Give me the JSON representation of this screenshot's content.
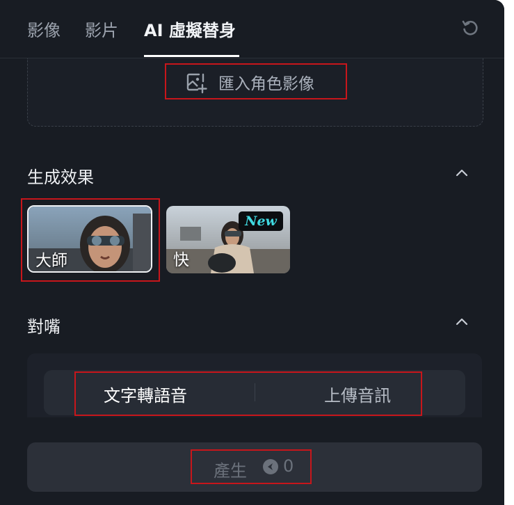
{
  "tabs": [
    {
      "label": "影像",
      "active": false
    },
    {
      "label": "影片",
      "active": false
    },
    {
      "label": "AI 虛擬替身",
      "active": true
    }
  ],
  "upload": {
    "label": "匯入角色影像",
    "icon": "image-add-icon"
  },
  "effects": {
    "title": "生成效果",
    "cards": [
      {
        "label": "大師",
        "selected": true
      },
      {
        "label": "快",
        "selected": false,
        "badge": "New"
      }
    ]
  },
  "lipsync": {
    "title": "對嘴",
    "options": [
      {
        "label": "文字轉語音",
        "active": true
      },
      {
        "label": "上傳音訊",
        "active": false
      }
    ]
  },
  "generate": {
    "label": "產生",
    "credits": "0",
    "icon": "credit-icon"
  },
  "colors": {
    "accent": "#ffffff",
    "highlight": "#c8161b",
    "panel": "#181c23",
    "badge_text": "#3fd9e0"
  }
}
